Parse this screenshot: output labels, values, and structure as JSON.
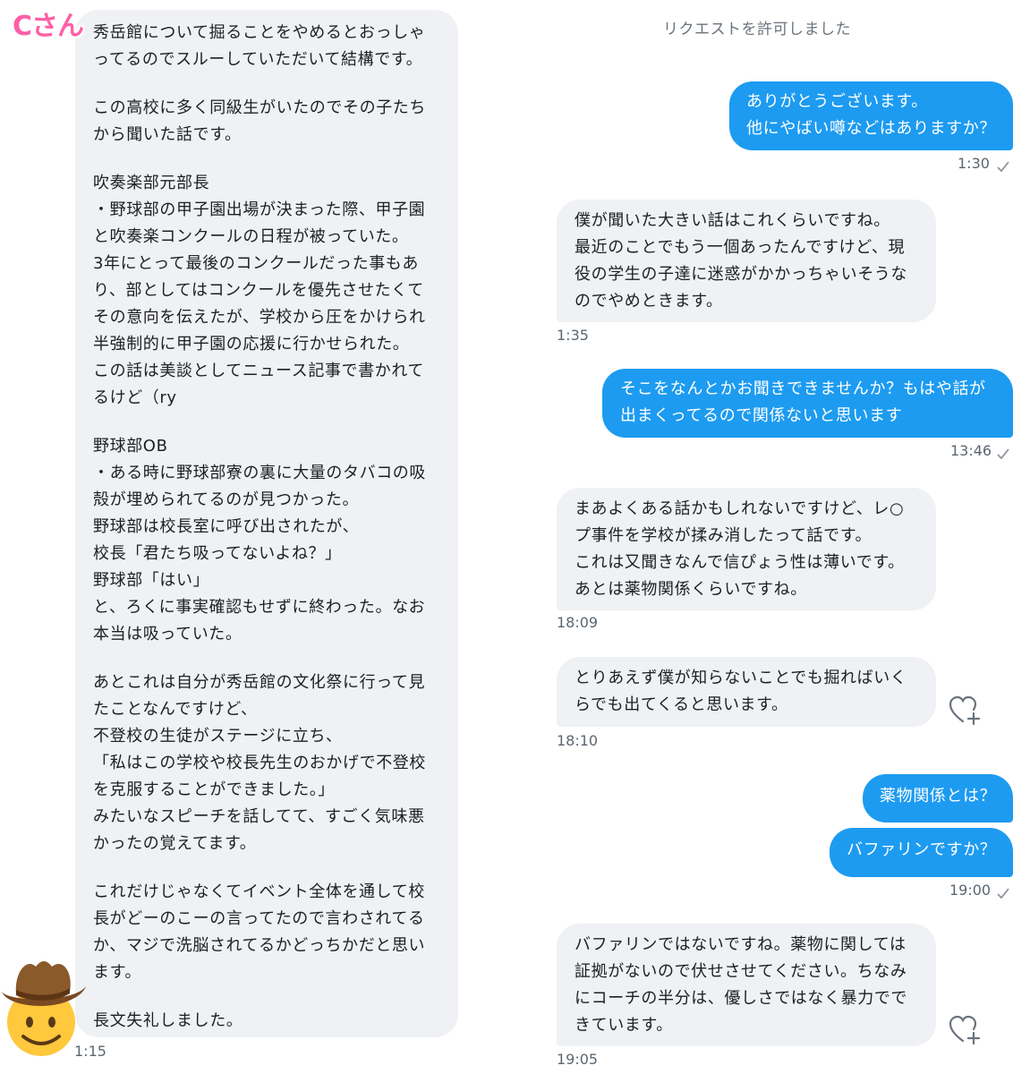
{
  "left_panel": {
    "sender_label": "Cさん",
    "message_paragraphs": [
      "秀岳館について掘ることをやめるとおっしゃ\nってるのでスルーしていただいて結構です。",
      "この高校に多く同級生がいたのでその子たち\nから聞いた話です。",
      "吹奏楽部元部長\n・野球部の甲子園出場が決まった際、甲子園\nと吹奏楽コンクールの日程が被っていた。\n3年にとって最後のコンクールだった事もあ\nり、部としてはコンクールを優先させたくて\nその意向を伝えたが、学校から圧をかけられ\n半強制的に甲子園の応援に行かせられた。\nこの話は美談としてニュース記事で書かれて\nるけど（ry",
      "野球部OB\n・ある時に野球部寮の裏に大量のタバコの吸\n殻が埋められてるのが見つかった。\n野球部は校長室に呼び出されたが、\n校長「君たち吸ってないよね？」\n野球部「はい」\nと、ろくに事実確認もせずに終わった。なお\n本当は吸っていた。",
      "あとこれは自分が秀岳館の文化祭に行って見\nたことなんですけど、\n不登校の生徒がステージに立ち、\n「私はこの学校や校長先生のおかげで不登校\nを克服することができました。」\nみたいなスピーチを話してて、すごく気味悪\nかったの覚えてます。",
      "これだけじゃなくてイベント全体を通して校\n長がどーのこーの言ってたので言わされてる\nか、マジで洗脳されてるかどっちかだと思い\nます。",
      "長文失礼しました。"
    ],
    "timestamp": "1:15"
  },
  "right_panel": {
    "system_note": "リクエストを許可しました",
    "messages": [
      {
        "text": "ありがとうございます。\n他にやばい噂などはありますか？"
      },
      {
        "text": "僕が聞いた大きい話はこれくらいですね。\n最近のことでもう一個あったんですけど、現\n役の学生の子達に迷惑がかかっちゃいそうな\nのでやめときます。"
      },
      {
        "text": "そこをなんとかお聞きできませんか？もはや話が\n出まくってるので関係ないと思います"
      },
      {
        "text": "まあよくある話かもしれないですけど、レ○\nプ事件を学校が揉み消したって話です。\nこれは又聞きなんで信ぴょう性は薄いです。\nあとは薬物関係くらいですね。"
      },
      {
        "text": "とりあえず僕が知らないことでも掘ればいく\nらでも出てくると思います。"
      },
      {
        "text": "薬物関係とは？"
      },
      {
        "text": "バファリンですか？"
      },
      {
        "text": "バファリンではないですね。薬物に関しては\n証拠がないので伏せさせてください。ちなみ\nにコーチの半分は、優しさではなく暴力でで\nきています。"
      }
    ],
    "timestamps": [
      "1:30",
      "1:35",
      "13:46",
      "18:09",
      "18:10",
      "19:00",
      "19:05"
    ]
  },
  "icons": {
    "read_receipt": "check-icon",
    "react": "heart-plus-icon",
    "avatar": "cowboy-emoji-icon"
  },
  "colors": {
    "sent_bubble": "#1d9bf0",
    "received_bubble": "#eff1f4",
    "sender_label": "#ff5fa6"
  }
}
